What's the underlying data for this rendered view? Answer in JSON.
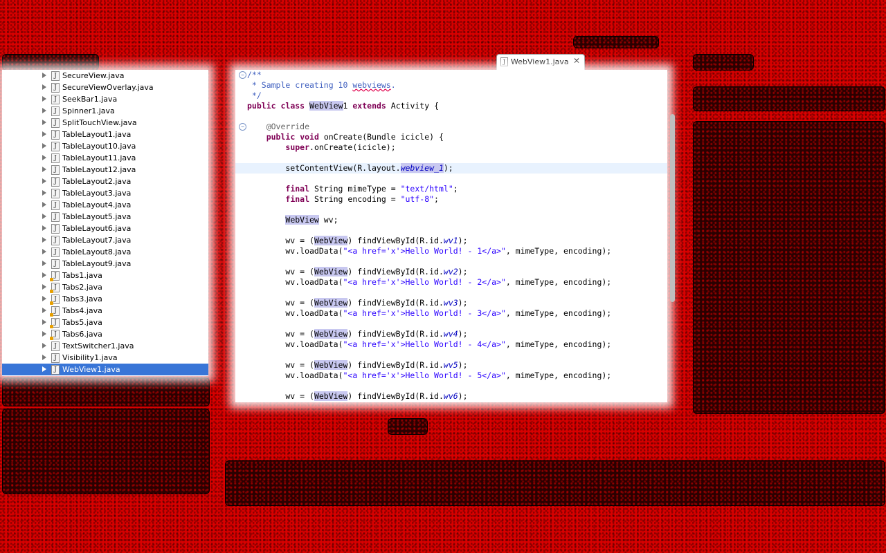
{
  "explorer": {
    "files": [
      {
        "name": "SecureView.java",
        "warn": false
      },
      {
        "name": "SecureViewOverlay.java",
        "warn": false
      },
      {
        "name": "SeekBar1.java",
        "warn": false
      },
      {
        "name": "Spinner1.java",
        "warn": false
      },
      {
        "name": "SplitTouchView.java",
        "warn": false
      },
      {
        "name": "TableLayout1.java",
        "warn": false
      },
      {
        "name": "TableLayout10.java",
        "warn": false
      },
      {
        "name": "TableLayout11.java",
        "warn": false
      },
      {
        "name": "TableLayout12.java",
        "warn": false
      },
      {
        "name": "TableLayout2.java",
        "warn": false
      },
      {
        "name": "TableLayout3.java",
        "warn": false
      },
      {
        "name": "TableLayout4.java",
        "warn": false
      },
      {
        "name": "TableLayout5.java",
        "warn": false
      },
      {
        "name": "TableLayout6.java",
        "warn": false
      },
      {
        "name": "TableLayout7.java",
        "warn": false
      },
      {
        "name": "TableLayout8.java",
        "warn": false
      },
      {
        "name": "TableLayout9.java",
        "warn": false
      },
      {
        "name": "Tabs1.java",
        "warn": true
      },
      {
        "name": "Tabs2.java",
        "warn": true
      },
      {
        "name": "Tabs3.java",
        "warn": true
      },
      {
        "name": "Tabs4.java",
        "warn": true
      },
      {
        "name": "Tabs5.java",
        "warn": true
      },
      {
        "name": "Tabs6.java",
        "warn": true
      },
      {
        "name": "TextSwitcher1.java",
        "warn": false
      },
      {
        "name": "Visibility1.java",
        "warn": false
      },
      {
        "name": "WebView1.java",
        "warn": false,
        "selected": true
      }
    ],
    "file_icon_glyph": "J"
  },
  "editor_tab": {
    "label": "WebView1.java",
    "close_glyph": "✕"
  },
  "code": [
    {
      "fold": true,
      "tokens": [
        {
          "t": "/**",
          "c": "cm"
        }
      ]
    },
    {
      "tokens": [
        {
          "t": " * Sample creating 10 ",
          "c": "cm"
        },
        {
          "t": "webviews",
          "c": "cm spell"
        },
        {
          "t": ".",
          "c": "cm"
        }
      ]
    },
    {
      "tokens": [
        {
          "t": " */",
          "c": "cm"
        }
      ]
    },
    {
      "tokens": [
        {
          "t": "public",
          "c": "kw"
        },
        {
          "t": " "
        },
        {
          "t": "class",
          "c": "kw"
        },
        {
          "t": " "
        },
        {
          "t": "WebView",
          "c": "occ"
        },
        {
          "t": "1 "
        },
        {
          "t": "extends",
          "c": "kw"
        },
        {
          "t": " Activity {"
        }
      ]
    },
    {
      "tokens": []
    },
    {
      "fold": true,
      "tokens": [
        {
          "t": "    "
        },
        {
          "t": "@Override",
          "c": "ann"
        }
      ]
    },
    {
      "tokens": [
        {
          "t": "    "
        },
        {
          "t": "public",
          "c": "kw"
        },
        {
          "t": " "
        },
        {
          "t": "void",
          "c": "kw"
        },
        {
          "t": " onCreate(Bundle icicle) {"
        }
      ]
    },
    {
      "tokens": [
        {
          "t": "        "
        },
        {
          "t": "super",
          "c": "kw"
        },
        {
          "t": ".onCreate(icicle);"
        }
      ]
    },
    {
      "tokens": []
    },
    {
      "hl": true,
      "tokens": [
        {
          "t": "        setContentView(R.layout."
        },
        {
          "t": "webview_1",
          "c": "fld occ"
        },
        {
          "t": ");"
        }
      ]
    },
    {
      "tokens": []
    },
    {
      "tokens": [
        {
          "t": "        "
        },
        {
          "t": "final",
          "c": "kw"
        },
        {
          "t": " String mimeType = "
        },
        {
          "t": "\"text/html\"",
          "c": "str"
        },
        {
          "t": ";"
        }
      ]
    },
    {
      "tokens": [
        {
          "t": "        "
        },
        {
          "t": "final",
          "c": "kw"
        },
        {
          "t": " String encoding = "
        },
        {
          "t": "\"utf-8\"",
          "c": "str"
        },
        {
          "t": ";"
        }
      ]
    },
    {
      "tokens": []
    },
    {
      "tokens": [
        {
          "t": "        "
        },
        {
          "t": "WebView",
          "c": "occ"
        },
        {
          "t": " wv;"
        }
      ]
    },
    {
      "tokens": []
    },
    {
      "tokens": [
        {
          "t": "        wv = ("
        },
        {
          "t": "WebView",
          "c": "occ"
        },
        {
          "t": ") findViewById(R.id."
        },
        {
          "t": "wv1",
          "c": "fld"
        },
        {
          "t": ");"
        }
      ]
    },
    {
      "tokens": [
        {
          "t": "        wv.loadData("
        },
        {
          "t": "\"<a href='x'>Hello World! - 1</a>\"",
          "c": "str"
        },
        {
          "t": ", mimeType, encoding);"
        }
      ]
    },
    {
      "tokens": []
    },
    {
      "tokens": [
        {
          "t": "        wv = ("
        },
        {
          "t": "WebView",
          "c": "occ"
        },
        {
          "t": ") findViewById(R.id."
        },
        {
          "t": "wv2",
          "c": "fld"
        },
        {
          "t": ");"
        }
      ]
    },
    {
      "tokens": [
        {
          "t": "        wv.loadData("
        },
        {
          "t": "\"<a href='x'>Hello World! - 2</a>\"",
          "c": "str"
        },
        {
          "t": ", mimeType, encoding);"
        }
      ]
    },
    {
      "tokens": []
    },
    {
      "tokens": [
        {
          "t": "        wv = ("
        },
        {
          "t": "WebView",
          "c": "occ"
        },
        {
          "t": ") findViewById(R.id."
        },
        {
          "t": "wv3",
          "c": "fld"
        },
        {
          "t": ");"
        }
      ]
    },
    {
      "tokens": [
        {
          "t": "        wv.loadData("
        },
        {
          "t": "\"<a href='x'>Hello World! - 3</a>\"",
          "c": "str"
        },
        {
          "t": ", mimeType, encoding);"
        }
      ]
    },
    {
      "tokens": []
    },
    {
      "tokens": [
        {
          "t": "        wv = ("
        },
        {
          "t": "WebView",
          "c": "occ"
        },
        {
          "t": ") findViewById(R.id."
        },
        {
          "t": "wv4",
          "c": "fld"
        },
        {
          "t": ");"
        }
      ]
    },
    {
      "tokens": [
        {
          "t": "        wv.loadData("
        },
        {
          "t": "\"<a href='x'>Hello World! - 4</a>\"",
          "c": "str"
        },
        {
          "t": ", mimeType, encoding);"
        }
      ]
    },
    {
      "tokens": []
    },
    {
      "tokens": [
        {
          "t": "        wv = ("
        },
        {
          "t": "WebView",
          "c": "occ"
        },
        {
          "t": ") findViewById(R.id."
        },
        {
          "t": "wv5",
          "c": "fld"
        },
        {
          "t": ");"
        }
      ]
    },
    {
      "tokens": [
        {
          "t": "        wv.loadData("
        },
        {
          "t": "\"<a href='x'>Hello World! - 5</a>\"",
          "c": "str"
        },
        {
          "t": ", mimeType, encoding);"
        }
      ]
    },
    {
      "tokens": []
    },
    {
      "tokens": [
        {
          "t": "        wv = ("
        },
        {
          "t": "WebView",
          "c": "occ"
        },
        {
          "t": ") findViewById(R.id."
        },
        {
          "t": "wv6",
          "c": "fld"
        },
        {
          "t": ");"
        }
      ]
    }
  ],
  "colors": {
    "background": "#d80000",
    "selection": "#3875d7",
    "current_line": "#e8f2fe",
    "keyword": "#7f0055",
    "comment": "#3f5fbf",
    "string": "#2a00ff"
  }
}
